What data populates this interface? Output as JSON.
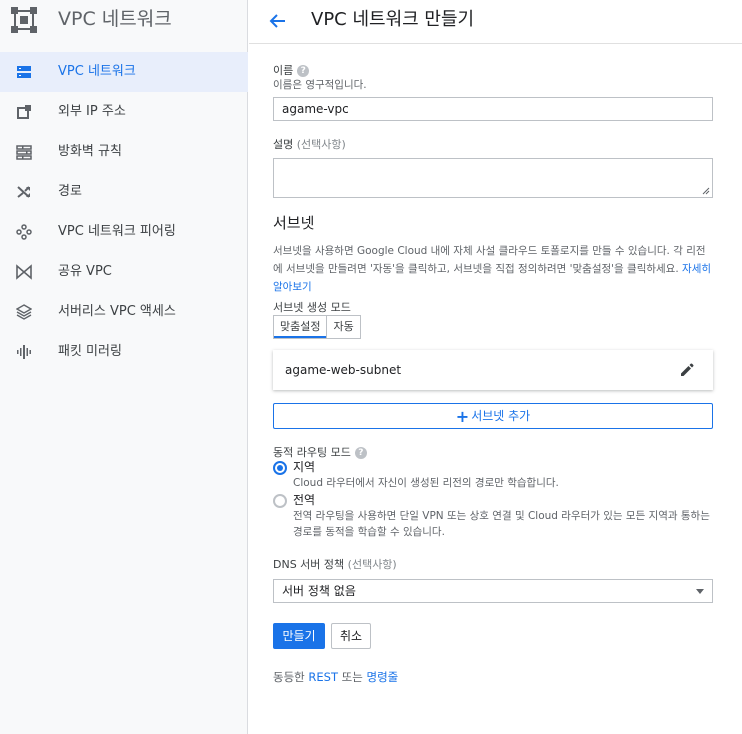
{
  "sidebar": {
    "title": "VPC 네트워크",
    "items": [
      {
        "label": "VPC 네트워크",
        "icon": "vpc-network-icon",
        "active": true
      },
      {
        "label": "외부 IP 주소",
        "icon": "external-ip-icon",
        "active": false
      },
      {
        "label": "방화벽 규칙",
        "icon": "firewall-icon",
        "active": false
      },
      {
        "label": "경로",
        "icon": "routes-icon",
        "active": false
      },
      {
        "label": "VPC 네트워크 피어링",
        "icon": "peering-icon",
        "active": false
      },
      {
        "label": "공유 VPC",
        "icon": "shared-vpc-icon",
        "active": false
      },
      {
        "label": "서버리스 VPC 액세스",
        "icon": "serverless-icon",
        "active": false
      },
      {
        "label": "패킷 미러링",
        "icon": "packet-mirroring-icon",
        "active": false
      }
    ]
  },
  "header": {
    "title": "VPC 네트워크 만들기"
  },
  "form": {
    "name_label": "이름",
    "name_hint": "이름은 영구적입니다.",
    "name_value": "agame-vpc",
    "desc_label": "설명",
    "desc_optional": "(선택사항)",
    "desc_value": "",
    "subnet_section_title": "서브넷",
    "subnet_desc": "서브넷을 사용하면 Google Cloud 내에 자체 사설 클라우드 토폴로지를 만들 수 있습니다. 각 리전에 서브넷을 만들려면 '자동'을 클릭하고, 서브넷을 직접 정의하려면 '맞춤설정'을 클릭하세요.",
    "subnet_desc_link": "자세히 알아보기",
    "subnet_mode_label": "서브넷 생성 모드",
    "subnet_mode_options": [
      "맞춤설정",
      "자동"
    ],
    "subnet_mode_selected": "맞춤설정",
    "subnets": [
      {
        "name": "agame-web-subnet"
      }
    ],
    "add_subnet_label": "서브넷 추가",
    "routing_label": "동적 라우팅 모드",
    "routing_options": [
      {
        "title": "지역",
        "desc": "Cloud 라우터에서 자신이 생성된 리전의 경로만 학습합니다.",
        "checked": true
      },
      {
        "title": "전역",
        "desc": "전역 라우팅을 사용하면 단일 VPN 또는 상호 연결 및 Cloud 라우터가 있는 모든 지역과 통하는 경로를 동적을 학습할 수 있습니다.",
        "checked": false
      }
    ],
    "dns_label": "DNS 서버 정책",
    "dns_optional": "(선택사항)",
    "dns_value": "서버 정책 없음",
    "create_button": "만들기",
    "cancel_button": "취소",
    "footer_prefix": "동등한",
    "footer_rest": "REST",
    "footer_or": "또는",
    "footer_cmd": "명령줄"
  },
  "colors": {
    "accent": "#1a73e8",
    "sidebar_bg": "#f8f9fa",
    "active_item_bg": "#e8eefb"
  }
}
